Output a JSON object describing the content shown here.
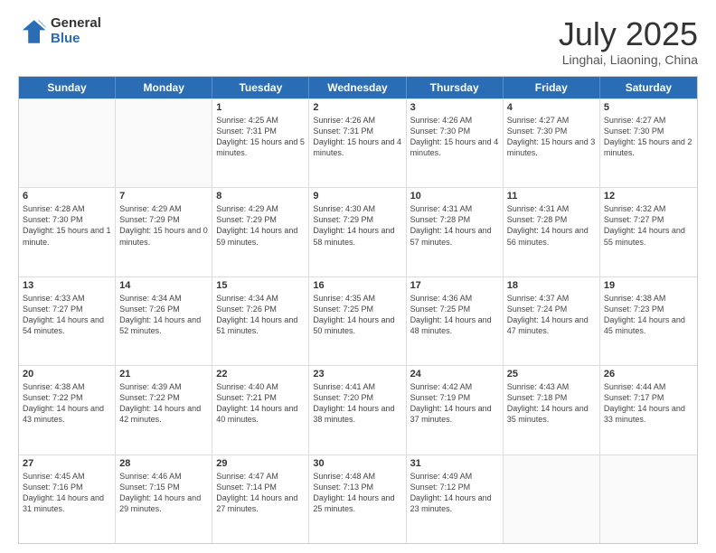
{
  "logo": {
    "general": "General",
    "blue": "Blue"
  },
  "title": {
    "month": "July 2025",
    "location": "Linghai, Liaoning, China"
  },
  "weekdays": [
    "Sunday",
    "Monday",
    "Tuesday",
    "Wednesday",
    "Thursday",
    "Friday",
    "Saturday"
  ],
  "rows": [
    [
      {
        "day": "",
        "text": ""
      },
      {
        "day": "",
        "text": ""
      },
      {
        "day": "1",
        "text": "Sunrise: 4:25 AM\nSunset: 7:31 PM\nDaylight: 15 hours and 5 minutes."
      },
      {
        "day": "2",
        "text": "Sunrise: 4:26 AM\nSunset: 7:31 PM\nDaylight: 15 hours and 4 minutes."
      },
      {
        "day": "3",
        "text": "Sunrise: 4:26 AM\nSunset: 7:30 PM\nDaylight: 15 hours and 4 minutes."
      },
      {
        "day": "4",
        "text": "Sunrise: 4:27 AM\nSunset: 7:30 PM\nDaylight: 15 hours and 3 minutes."
      },
      {
        "day": "5",
        "text": "Sunrise: 4:27 AM\nSunset: 7:30 PM\nDaylight: 15 hours and 2 minutes."
      }
    ],
    [
      {
        "day": "6",
        "text": "Sunrise: 4:28 AM\nSunset: 7:30 PM\nDaylight: 15 hours and 1 minute."
      },
      {
        "day": "7",
        "text": "Sunrise: 4:29 AM\nSunset: 7:29 PM\nDaylight: 15 hours and 0 minutes."
      },
      {
        "day": "8",
        "text": "Sunrise: 4:29 AM\nSunset: 7:29 PM\nDaylight: 14 hours and 59 minutes."
      },
      {
        "day": "9",
        "text": "Sunrise: 4:30 AM\nSunset: 7:29 PM\nDaylight: 14 hours and 58 minutes."
      },
      {
        "day": "10",
        "text": "Sunrise: 4:31 AM\nSunset: 7:28 PM\nDaylight: 14 hours and 57 minutes."
      },
      {
        "day": "11",
        "text": "Sunrise: 4:31 AM\nSunset: 7:28 PM\nDaylight: 14 hours and 56 minutes."
      },
      {
        "day": "12",
        "text": "Sunrise: 4:32 AM\nSunset: 7:27 PM\nDaylight: 14 hours and 55 minutes."
      }
    ],
    [
      {
        "day": "13",
        "text": "Sunrise: 4:33 AM\nSunset: 7:27 PM\nDaylight: 14 hours and 54 minutes."
      },
      {
        "day": "14",
        "text": "Sunrise: 4:34 AM\nSunset: 7:26 PM\nDaylight: 14 hours and 52 minutes."
      },
      {
        "day": "15",
        "text": "Sunrise: 4:34 AM\nSunset: 7:26 PM\nDaylight: 14 hours and 51 minutes."
      },
      {
        "day": "16",
        "text": "Sunrise: 4:35 AM\nSunset: 7:25 PM\nDaylight: 14 hours and 50 minutes."
      },
      {
        "day": "17",
        "text": "Sunrise: 4:36 AM\nSunset: 7:25 PM\nDaylight: 14 hours and 48 minutes."
      },
      {
        "day": "18",
        "text": "Sunrise: 4:37 AM\nSunset: 7:24 PM\nDaylight: 14 hours and 47 minutes."
      },
      {
        "day": "19",
        "text": "Sunrise: 4:38 AM\nSunset: 7:23 PM\nDaylight: 14 hours and 45 minutes."
      }
    ],
    [
      {
        "day": "20",
        "text": "Sunrise: 4:38 AM\nSunset: 7:22 PM\nDaylight: 14 hours and 43 minutes."
      },
      {
        "day": "21",
        "text": "Sunrise: 4:39 AM\nSunset: 7:22 PM\nDaylight: 14 hours and 42 minutes."
      },
      {
        "day": "22",
        "text": "Sunrise: 4:40 AM\nSunset: 7:21 PM\nDaylight: 14 hours and 40 minutes."
      },
      {
        "day": "23",
        "text": "Sunrise: 4:41 AM\nSunset: 7:20 PM\nDaylight: 14 hours and 38 minutes."
      },
      {
        "day": "24",
        "text": "Sunrise: 4:42 AM\nSunset: 7:19 PM\nDaylight: 14 hours and 37 minutes."
      },
      {
        "day": "25",
        "text": "Sunrise: 4:43 AM\nSunset: 7:18 PM\nDaylight: 14 hours and 35 minutes."
      },
      {
        "day": "26",
        "text": "Sunrise: 4:44 AM\nSunset: 7:17 PM\nDaylight: 14 hours and 33 minutes."
      }
    ],
    [
      {
        "day": "27",
        "text": "Sunrise: 4:45 AM\nSunset: 7:16 PM\nDaylight: 14 hours and 31 minutes."
      },
      {
        "day": "28",
        "text": "Sunrise: 4:46 AM\nSunset: 7:15 PM\nDaylight: 14 hours and 29 minutes."
      },
      {
        "day": "29",
        "text": "Sunrise: 4:47 AM\nSunset: 7:14 PM\nDaylight: 14 hours and 27 minutes."
      },
      {
        "day": "30",
        "text": "Sunrise: 4:48 AM\nSunset: 7:13 PM\nDaylight: 14 hours and 25 minutes."
      },
      {
        "day": "31",
        "text": "Sunrise: 4:49 AM\nSunset: 7:12 PM\nDaylight: 14 hours and 23 minutes."
      },
      {
        "day": "",
        "text": ""
      },
      {
        "day": "",
        "text": ""
      }
    ]
  ]
}
